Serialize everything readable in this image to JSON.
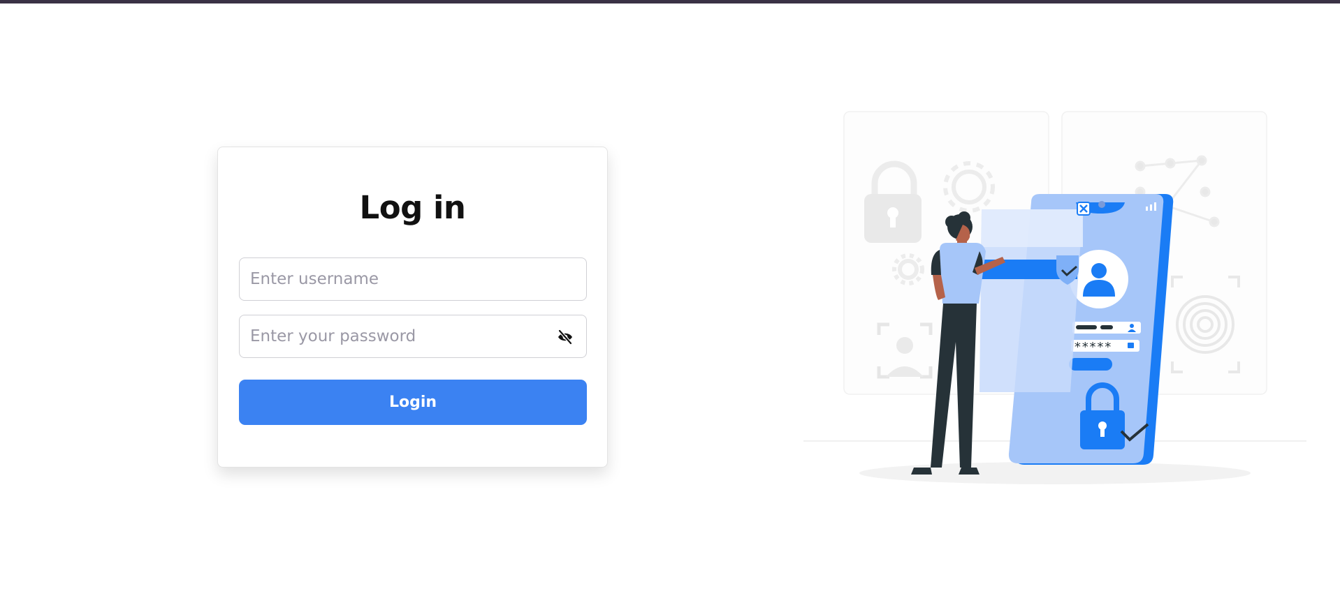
{
  "login": {
    "title": "Log in",
    "username_placeholder": "Enter username",
    "password_placeholder": "Enter your password",
    "submit_label": "Login"
  },
  "illustration": {
    "password_mask": "*****"
  },
  "colors": {
    "accent": "#3b82f2",
    "top_bar": "#3a3245",
    "illustration_blue": "#1a7cf5"
  }
}
